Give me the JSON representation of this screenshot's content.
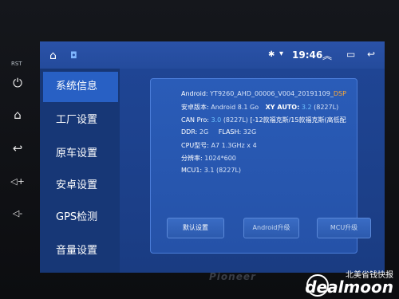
{
  "hardware": {
    "label_top": "RST",
    "buttons": [
      {
        "name": "power-icon",
        "glyph": "⏻"
      },
      {
        "name": "home-icon",
        "glyph": "⌂"
      },
      {
        "name": "back-icon",
        "glyph": "↩"
      },
      {
        "name": "volume-up-icon",
        "glyph": "◁+"
      },
      {
        "name": "volume-down-icon",
        "glyph": "◁-"
      }
    ]
  },
  "statusbar": {
    "home_glyph": "⌂",
    "app_glyph": "◘",
    "bluetooth_glyph": "✱",
    "signal_glyph": "▾",
    "time": "19:46",
    "collapse_glyph": "︽",
    "recent_glyph": "▭",
    "back_glyph": "↩"
  },
  "sidebar": {
    "items": [
      {
        "label": "系统信息",
        "active": true
      },
      {
        "label": "工厂设置",
        "active": false
      },
      {
        "label": "原车设置",
        "active": false
      },
      {
        "label": "安卓设置",
        "active": false
      },
      {
        "label": "GPS检测",
        "active": false
      },
      {
        "label": "音量设置",
        "active": false
      }
    ]
  },
  "info": {
    "android_label": "Android:",
    "android_value": "YT9260_AHD_00006_V004_20191109_",
    "android_suffix": "DSP",
    "android_ver_label": "安卓版本:",
    "android_ver_value": "Android 8.1 Go",
    "xy_auto_label": "XY AUTO:",
    "xy_auto_value": "3.2",
    "xy_auto_suffix": "(8227L)",
    "can_label": "CAN Pro:",
    "can_value": "3.0",
    "can_suffix": "(8227L)",
    "can_model": "[-12款福克斯/15款福克斯(高低配",
    "ddr_label": "DDR:",
    "ddr_value": "2G",
    "flash_label": "FLASH:",
    "flash_value": "32G",
    "cpu_label": "CPU型号:",
    "cpu_value": "A7 1.3GHz x 4",
    "res_label": "分辨率:",
    "res_value": "1024*600",
    "mcu_label": "MCU1:",
    "mcu_value": "3.1",
    "mcu_suffix": "(8227L)"
  },
  "buttons": {
    "default": "默认设置",
    "android_upgrade": "Android升级",
    "mcu_upgrade": "MCU升级"
  },
  "brand": {
    "bezel_text": "Pioneer",
    "watermark_cn": "北美省钱快报",
    "watermark_en": "dealmoon"
  },
  "colors": {
    "accent": "#2860c4",
    "highlight": "#6fc2ff",
    "dsp": "#ffaa33"
  }
}
